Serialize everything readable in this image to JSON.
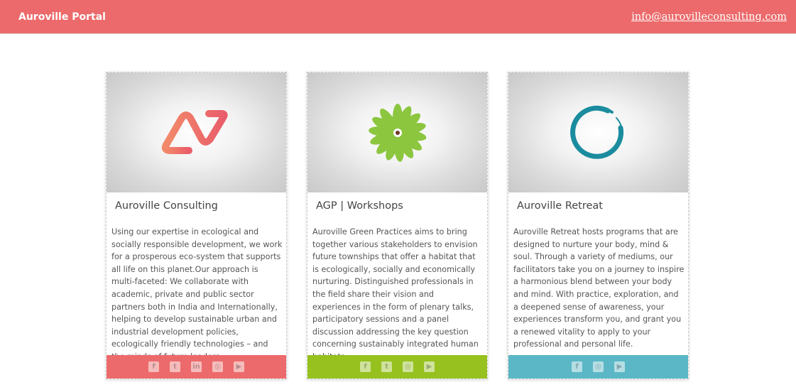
{
  "header": {
    "brand": "Auroville Portal",
    "email": "info@aurovilleconsulting.com",
    "background": "#ec6a6b"
  },
  "cards": [
    {
      "title": "Auroville Consulting",
      "logo": "consulting-logo-icon",
      "text": "Using our expertise in ecological and socially responsible development, we work for a prosperous eco-system that supports all life on this planet.Our approach is multi-faceted: We collaborate with academic, private and public sector partners both in India and Internationally, helping to develop sustainable urban and industrial development policies, ecologically friendly technologies – and the minds of future leaders.",
      "footer_color": "#ec6a6b",
      "social": [
        "facebook-icon",
        "twitter-icon",
        "linkedin-icon",
        "instagram-icon",
        "youtube-icon"
      ]
    },
    {
      "title": "AGP | Workshops",
      "logo": "green-flower-logo-icon",
      "text": "Auroville Green Practices aims to bring together various stakeholders to envision future townships that offer a habitat that is ecologically, socially and economically nurturing. Distinguished professionals in the field share their vision and experiences in the form of plenary talks, participatory sessions and a panel discussion addressing the key question concerning sustainably integrated human habitats.",
      "footer_color": "#96c11f",
      "social": [
        "facebook-icon",
        "twitter-icon",
        "instagram-icon",
        "youtube-icon"
      ]
    },
    {
      "title": "Auroville Retreat",
      "logo": "enso-circle-logo-icon",
      "text": "Auroville Retreat hosts programs that are designed to nurture your body, mind & soul. Through a variety of mediums, our facilitators take you on a journey to inspire a harmonious blend between your body and mind. With practice, exploration, and a deepened sense of awareness, your experiences transform you, and grant you a renewed vitality to apply to your professional and personal life.",
      "footer_color": "#5bb7c6",
      "social": [
        "facebook-icon",
        "instagram-icon",
        "youtube-icon"
      ]
    }
  ]
}
